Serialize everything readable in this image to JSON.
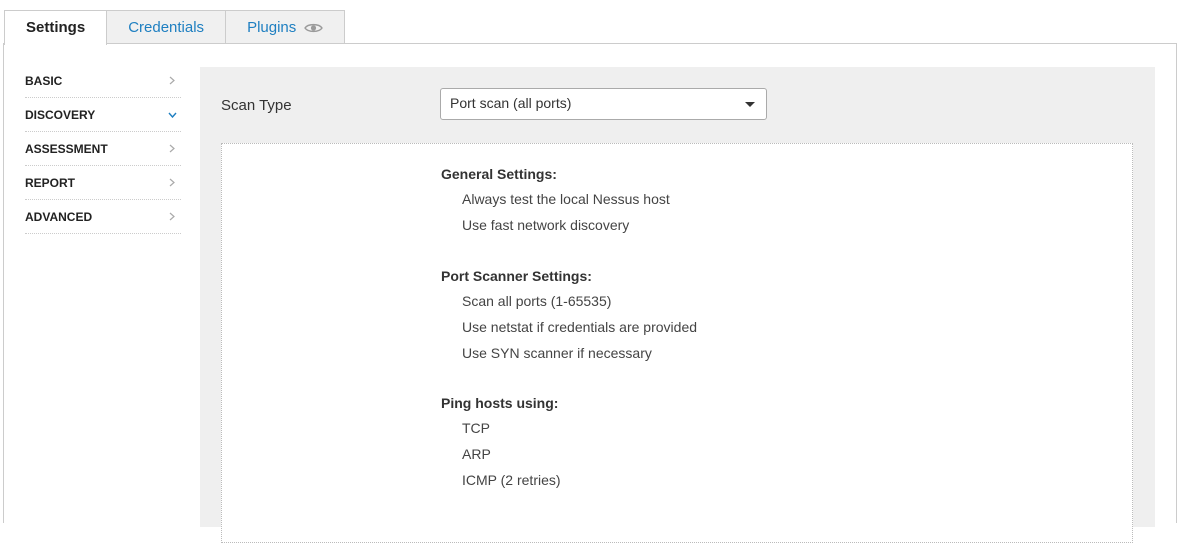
{
  "tabs": [
    {
      "label": "Settings",
      "active": true
    },
    {
      "label": "Credentials",
      "active": false
    },
    {
      "label": "Plugins",
      "active": false,
      "icon": "eye-icon"
    }
  ],
  "sidebar": {
    "items": [
      {
        "label": "BASIC",
        "icon": "chevron-right-icon"
      },
      {
        "label": "DISCOVERY",
        "icon": "chevron-down-icon",
        "expanded": true
      },
      {
        "label": "ASSESSMENT",
        "icon": "chevron-right-icon"
      },
      {
        "label": "REPORT",
        "icon": "chevron-right-icon"
      },
      {
        "label": "ADVANCED",
        "icon": "chevron-right-icon"
      }
    ]
  },
  "main": {
    "scan_type_label": "Scan Type",
    "scan_type_value": "Port scan (all ports)",
    "sections": [
      {
        "title": "General Settings:",
        "items": [
          "Always test the local Nessus host",
          "Use fast network discovery"
        ]
      },
      {
        "title": "Port Scanner Settings:",
        "items": [
          "Scan all ports (1-65535)",
          "Use netstat if credentials are provided",
          "Use SYN scanner if necessary"
        ]
      },
      {
        "title": "Ping hosts using:",
        "items": [
          "TCP",
          "ARP",
          "ICMP (2 retries)"
        ]
      }
    ]
  },
  "colors": {
    "link": "#1e7fc1",
    "panel_bg": "#efefef",
    "border": "#cccccc"
  }
}
